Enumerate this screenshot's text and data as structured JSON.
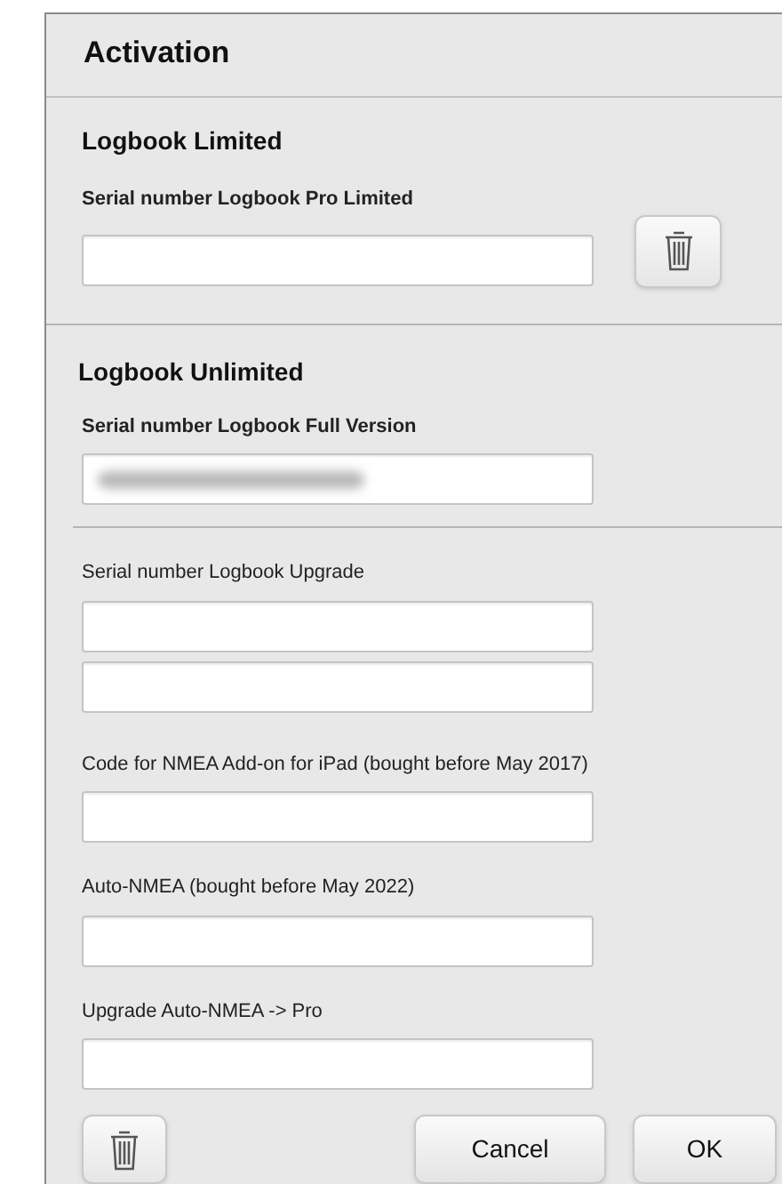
{
  "title": "Activation",
  "limited": {
    "heading": "Logbook Limited",
    "label": "Serial number Logbook Pro Limited",
    "redacted": false
  },
  "unlimited": {
    "heading": "Logbook Unlimited",
    "label": "Serial number Logbook Full Version",
    "redacted": true
  },
  "upgrade_groups": [
    {
      "label": "Serial number Logbook Upgrade",
      "fields": [
        {
          "kind": "text"
        },
        {
          "kind": "text"
        }
      ]
    },
    {
      "label": "Code for NMEA Add-on for iPad (bought before May 2017)",
      "fields": [
        {
          "kind": "text"
        }
      ]
    },
    {
      "label": "Auto-NMEA (bought before May 2022)",
      "fields": [
        {
          "kind": "text"
        }
      ]
    },
    {
      "label": "Upgrade Auto-NMEA -> Pro",
      "fields": [
        {
          "kind": "text"
        }
      ]
    }
  ],
  "buttons": [
    "Cancel",
    "OK"
  ]
}
